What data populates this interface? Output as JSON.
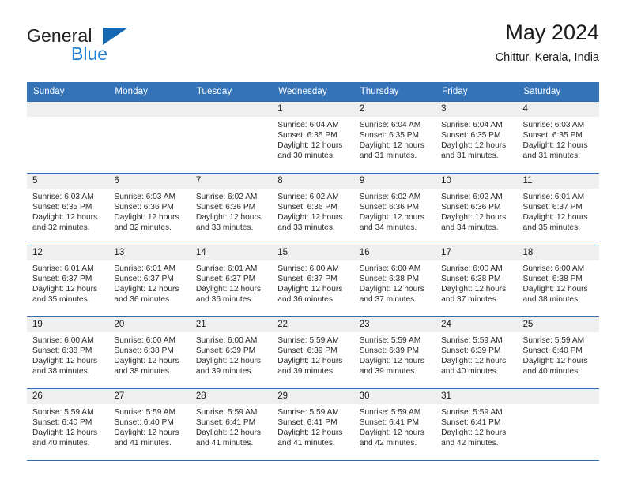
{
  "brand": {
    "name_part1": "General",
    "name_part2": "Blue",
    "logo_icon": "triangle-logo-icon"
  },
  "header": {
    "title": "May 2024",
    "location": "Chittur, Kerala, India"
  },
  "weekday_headers": [
    "Sunday",
    "Monday",
    "Tuesday",
    "Wednesday",
    "Thursday",
    "Friday",
    "Saturday"
  ],
  "colors": {
    "header_bar": "#3573b9",
    "row_rule": "#2e6daf",
    "daynum_band": "#efefef",
    "brand_blue": "#1f7fd4",
    "logo_blue": "#1668b3"
  },
  "weeks": [
    [
      {
        "day": "",
        "sunrise": "",
        "sunset": "",
        "daylight_line1": "",
        "daylight_line2": ""
      },
      {
        "day": "",
        "sunrise": "",
        "sunset": "",
        "daylight_line1": "",
        "daylight_line2": ""
      },
      {
        "day": "",
        "sunrise": "",
        "sunset": "",
        "daylight_line1": "",
        "daylight_line2": ""
      },
      {
        "day": "1",
        "sunrise": "Sunrise: 6:04 AM",
        "sunset": "Sunset: 6:35 PM",
        "daylight_line1": "Daylight: 12 hours",
        "daylight_line2": "and 30 minutes."
      },
      {
        "day": "2",
        "sunrise": "Sunrise: 6:04 AM",
        "sunset": "Sunset: 6:35 PM",
        "daylight_line1": "Daylight: 12 hours",
        "daylight_line2": "and 31 minutes."
      },
      {
        "day": "3",
        "sunrise": "Sunrise: 6:04 AM",
        "sunset": "Sunset: 6:35 PM",
        "daylight_line1": "Daylight: 12 hours",
        "daylight_line2": "and 31 minutes."
      },
      {
        "day": "4",
        "sunrise": "Sunrise: 6:03 AM",
        "sunset": "Sunset: 6:35 PM",
        "daylight_line1": "Daylight: 12 hours",
        "daylight_line2": "and 31 minutes."
      }
    ],
    [
      {
        "day": "5",
        "sunrise": "Sunrise: 6:03 AM",
        "sunset": "Sunset: 6:35 PM",
        "daylight_line1": "Daylight: 12 hours",
        "daylight_line2": "and 32 minutes."
      },
      {
        "day": "6",
        "sunrise": "Sunrise: 6:03 AM",
        "sunset": "Sunset: 6:36 PM",
        "daylight_line1": "Daylight: 12 hours",
        "daylight_line2": "and 32 minutes."
      },
      {
        "day": "7",
        "sunrise": "Sunrise: 6:02 AM",
        "sunset": "Sunset: 6:36 PM",
        "daylight_line1": "Daylight: 12 hours",
        "daylight_line2": "and 33 minutes."
      },
      {
        "day": "8",
        "sunrise": "Sunrise: 6:02 AM",
        "sunset": "Sunset: 6:36 PM",
        "daylight_line1": "Daylight: 12 hours",
        "daylight_line2": "and 33 minutes."
      },
      {
        "day": "9",
        "sunrise": "Sunrise: 6:02 AM",
        "sunset": "Sunset: 6:36 PM",
        "daylight_line1": "Daylight: 12 hours",
        "daylight_line2": "and 34 minutes."
      },
      {
        "day": "10",
        "sunrise": "Sunrise: 6:02 AM",
        "sunset": "Sunset: 6:36 PM",
        "daylight_line1": "Daylight: 12 hours",
        "daylight_line2": "and 34 minutes."
      },
      {
        "day": "11",
        "sunrise": "Sunrise: 6:01 AM",
        "sunset": "Sunset: 6:37 PM",
        "daylight_line1": "Daylight: 12 hours",
        "daylight_line2": "and 35 minutes."
      }
    ],
    [
      {
        "day": "12",
        "sunrise": "Sunrise: 6:01 AM",
        "sunset": "Sunset: 6:37 PM",
        "daylight_line1": "Daylight: 12 hours",
        "daylight_line2": "and 35 minutes."
      },
      {
        "day": "13",
        "sunrise": "Sunrise: 6:01 AM",
        "sunset": "Sunset: 6:37 PM",
        "daylight_line1": "Daylight: 12 hours",
        "daylight_line2": "and 36 minutes."
      },
      {
        "day": "14",
        "sunrise": "Sunrise: 6:01 AM",
        "sunset": "Sunset: 6:37 PM",
        "daylight_line1": "Daylight: 12 hours",
        "daylight_line2": "and 36 minutes."
      },
      {
        "day": "15",
        "sunrise": "Sunrise: 6:00 AM",
        "sunset": "Sunset: 6:37 PM",
        "daylight_line1": "Daylight: 12 hours",
        "daylight_line2": "and 36 minutes."
      },
      {
        "day": "16",
        "sunrise": "Sunrise: 6:00 AM",
        "sunset": "Sunset: 6:38 PM",
        "daylight_line1": "Daylight: 12 hours",
        "daylight_line2": "and 37 minutes."
      },
      {
        "day": "17",
        "sunrise": "Sunrise: 6:00 AM",
        "sunset": "Sunset: 6:38 PM",
        "daylight_line1": "Daylight: 12 hours",
        "daylight_line2": "and 37 minutes."
      },
      {
        "day": "18",
        "sunrise": "Sunrise: 6:00 AM",
        "sunset": "Sunset: 6:38 PM",
        "daylight_line1": "Daylight: 12 hours",
        "daylight_line2": "and 38 minutes."
      }
    ],
    [
      {
        "day": "19",
        "sunrise": "Sunrise: 6:00 AM",
        "sunset": "Sunset: 6:38 PM",
        "daylight_line1": "Daylight: 12 hours",
        "daylight_line2": "and 38 minutes."
      },
      {
        "day": "20",
        "sunrise": "Sunrise: 6:00 AM",
        "sunset": "Sunset: 6:38 PM",
        "daylight_line1": "Daylight: 12 hours",
        "daylight_line2": "and 38 minutes."
      },
      {
        "day": "21",
        "sunrise": "Sunrise: 6:00 AM",
        "sunset": "Sunset: 6:39 PM",
        "daylight_line1": "Daylight: 12 hours",
        "daylight_line2": "and 39 minutes."
      },
      {
        "day": "22",
        "sunrise": "Sunrise: 5:59 AM",
        "sunset": "Sunset: 6:39 PM",
        "daylight_line1": "Daylight: 12 hours",
        "daylight_line2": "and 39 minutes."
      },
      {
        "day": "23",
        "sunrise": "Sunrise: 5:59 AM",
        "sunset": "Sunset: 6:39 PM",
        "daylight_line1": "Daylight: 12 hours",
        "daylight_line2": "and 39 minutes."
      },
      {
        "day": "24",
        "sunrise": "Sunrise: 5:59 AM",
        "sunset": "Sunset: 6:39 PM",
        "daylight_line1": "Daylight: 12 hours",
        "daylight_line2": "and 40 minutes."
      },
      {
        "day": "25",
        "sunrise": "Sunrise: 5:59 AM",
        "sunset": "Sunset: 6:40 PM",
        "daylight_line1": "Daylight: 12 hours",
        "daylight_line2": "and 40 minutes."
      }
    ],
    [
      {
        "day": "26",
        "sunrise": "Sunrise: 5:59 AM",
        "sunset": "Sunset: 6:40 PM",
        "daylight_line1": "Daylight: 12 hours",
        "daylight_line2": "and 40 minutes."
      },
      {
        "day": "27",
        "sunrise": "Sunrise: 5:59 AM",
        "sunset": "Sunset: 6:40 PM",
        "daylight_line1": "Daylight: 12 hours",
        "daylight_line2": "and 41 minutes."
      },
      {
        "day": "28",
        "sunrise": "Sunrise: 5:59 AM",
        "sunset": "Sunset: 6:41 PM",
        "daylight_line1": "Daylight: 12 hours",
        "daylight_line2": "and 41 minutes."
      },
      {
        "day": "29",
        "sunrise": "Sunrise: 5:59 AM",
        "sunset": "Sunset: 6:41 PM",
        "daylight_line1": "Daylight: 12 hours",
        "daylight_line2": "and 41 minutes."
      },
      {
        "day": "30",
        "sunrise": "Sunrise: 5:59 AM",
        "sunset": "Sunset: 6:41 PM",
        "daylight_line1": "Daylight: 12 hours",
        "daylight_line2": "and 42 minutes."
      },
      {
        "day": "31",
        "sunrise": "Sunrise: 5:59 AM",
        "sunset": "Sunset: 6:41 PM",
        "daylight_line1": "Daylight: 12 hours",
        "daylight_line2": "and 42 minutes."
      },
      {
        "day": "",
        "sunrise": "",
        "sunset": "",
        "daylight_line1": "",
        "daylight_line2": ""
      }
    ]
  ]
}
